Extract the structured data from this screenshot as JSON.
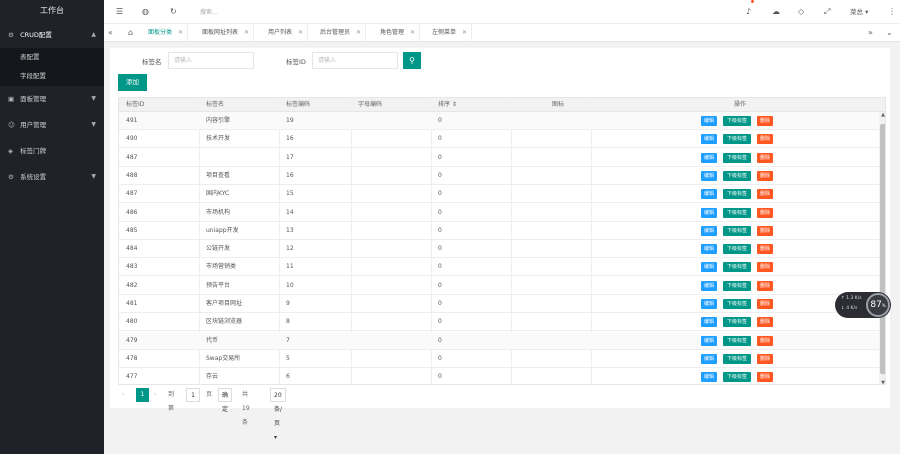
{
  "app": {
    "title": "工作台"
  },
  "sidebar": {
    "groups": [
      {
        "label": "CRUD配置",
        "icon": "settings-icon",
        "open": true,
        "items": [
          "表配置",
          "字段配置"
        ]
      },
      {
        "label": "面板管理",
        "icon": "panel-icon",
        "open": false
      },
      {
        "label": "用户管理",
        "icon": "user-icon",
        "open": false
      },
      {
        "label": "标签门牌",
        "icon": "tag-icon",
        "open": false
      },
      {
        "label": "系统设置",
        "icon": "gear-icon",
        "open": false
      }
    ]
  },
  "topbar": {
    "search_placeholder": "搜索...",
    "user": "菜总 ▾"
  },
  "tabs": [
    {
      "label": "面板分类",
      "active": true
    },
    {
      "label": "面板网址列表"
    },
    {
      "label": "用户列表"
    },
    {
      "label": "后台管理员"
    },
    {
      "label": "角色管理"
    },
    {
      "label": "左侧菜单"
    }
  ],
  "filter": {
    "name_label": "标签名",
    "name_placeholder": "请输入",
    "id_label": "标签ID",
    "id_placeholder": "请输入"
  },
  "add_label": "添加",
  "table": {
    "headers": [
      "标签ID",
      "标签名",
      "标签编码",
      "字母编码",
      "排序 ⇕",
      "图标",
      "操作"
    ],
    "actions": {
      "edit": "编辑",
      "download": "下级标签",
      "delete": "删除"
    },
    "rows": [
      {
        "id": "491",
        "name": "内容引擎",
        "code": "19",
        "sort": "0"
      },
      {
        "id": "490",
        "name": "技术开发",
        "code": "16",
        "sort": "0"
      },
      {
        "id": "487",
        "name": "",
        "code": "17",
        "sort": "0"
      },
      {
        "id": "488",
        "name": "项目查看",
        "code": "16",
        "sort": "0"
      },
      {
        "id": "487",
        "name": "国内KYC",
        "code": "15",
        "sort": "0"
      },
      {
        "id": "486",
        "name": "市场机构",
        "code": "14",
        "sort": "0"
      },
      {
        "id": "485",
        "name": "uniapp开发",
        "code": "13",
        "sort": "0"
      },
      {
        "id": "484",
        "name": "公链开发",
        "code": "12",
        "sort": "0"
      },
      {
        "id": "483",
        "name": "市场营销类",
        "code": "11",
        "sort": "0"
      },
      {
        "id": "482",
        "name": "预告平台",
        "code": "10",
        "sort": "0"
      },
      {
        "id": "481",
        "name": "客户项目网址",
        "code": "9",
        "sort": "0"
      },
      {
        "id": "480",
        "name": "区块链浏览器",
        "code": "8",
        "sort": "0"
      },
      {
        "id": "479",
        "name": "代币",
        "code": "7",
        "sort": "0"
      },
      {
        "id": "478",
        "name": "Swap交易所",
        "code": "5",
        "sort": "0"
      },
      {
        "id": "477",
        "name": "存云",
        "code": "6",
        "sort": "0"
      }
    ]
  },
  "pager": {
    "current": "1",
    "goto_label": "到第",
    "goto_value": "1",
    "page_unit": "页",
    "confirm": "确定",
    "total": "共 19 条",
    "size": "20 条/页 ▾"
  },
  "widget": {
    "percent": "87",
    "up": "1.3 K/s",
    "down": "4 K/s"
  },
  "colors": {
    "accent": "#009688",
    "edit": "#1e9fff",
    "delete": "#ff5722",
    "sidebar": "#20222a"
  }
}
